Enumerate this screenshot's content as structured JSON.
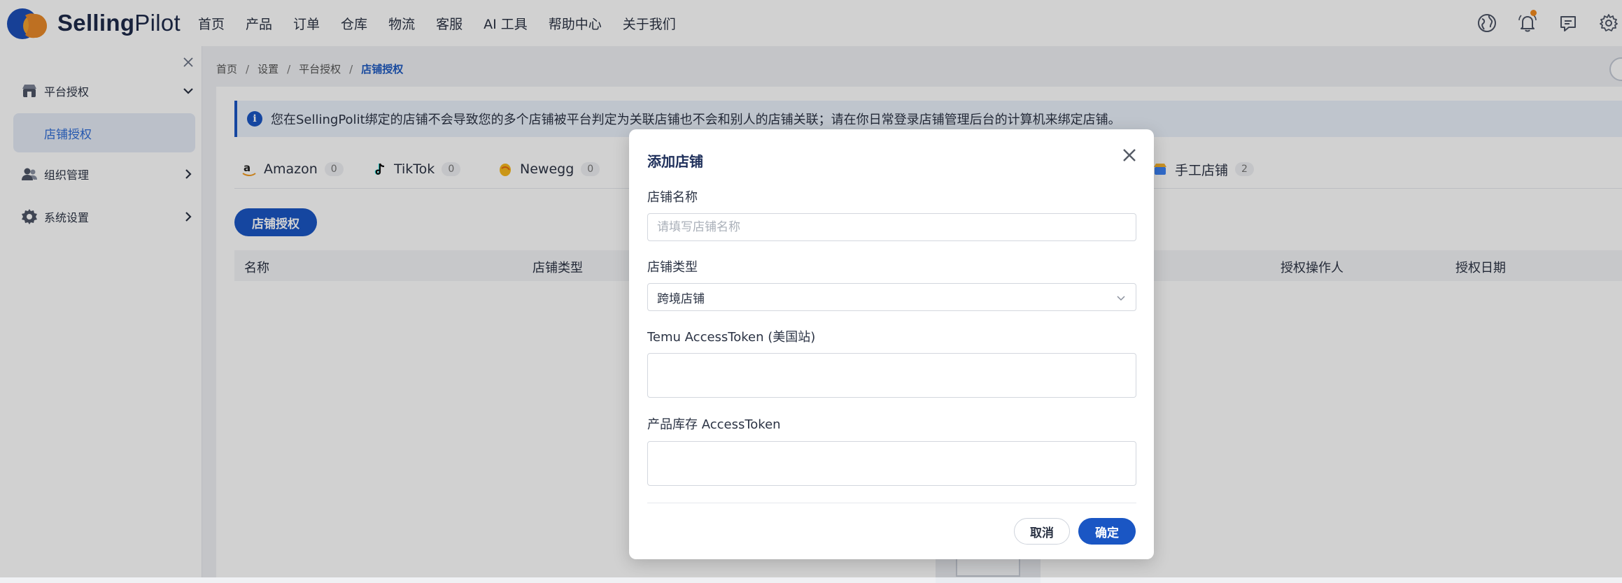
{
  "brand": {
    "bold": "Selling",
    "rest": "Pilot"
  },
  "nav": [
    "首页",
    "产品",
    "订单",
    "仓库",
    "物流",
    "客服",
    "AI 工具",
    "帮助中心",
    "关于我们"
  ],
  "sidebar": {
    "groups": [
      {
        "label": "平台授权",
        "expanded": true
      },
      {
        "label": "组织管理",
        "expanded": false
      },
      {
        "label": "系统设置",
        "expanded": false
      }
    ],
    "active_sub": "店铺授权"
  },
  "breadcrumb": [
    "首页",
    "设置",
    "平台授权",
    "店铺授权"
  ],
  "notice": "您在SellingPolit绑定的店铺不会导致您的多个店铺被平台判定为关联店铺也不会和别人的店铺关联；请在你日常登录店铺管理后台的计算机来绑定店铺。",
  "tabs": [
    {
      "label": "Amazon",
      "count": "0"
    },
    {
      "label": "TikTok",
      "count": "0"
    },
    {
      "label": "Newegg",
      "count": "0"
    },
    {
      "label": "手工店铺",
      "count": "2"
    }
  ],
  "auth_button": "店铺授权",
  "table_headers": [
    "名称",
    "店铺类型",
    "授权操作人",
    "授权日期"
  ],
  "modal": {
    "title": "添加店铺",
    "name_label": "店铺名称",
    "name_placeholder": "请填写店铺名称",
    "type_label": "店铺类型",
    "type_value": "跨境店铺",
    "token_label": "Temu AccessToken (美国站)",
    "stock_label": "产品库存 AccessToken",
    "cancel": "取消",
    "ok": "确定"
  },
  "colors": {
    "accent": "#1a56c4",
    "active_bg": "#e4ebf6",
    "badge": "#f28a1e"
  }
}
